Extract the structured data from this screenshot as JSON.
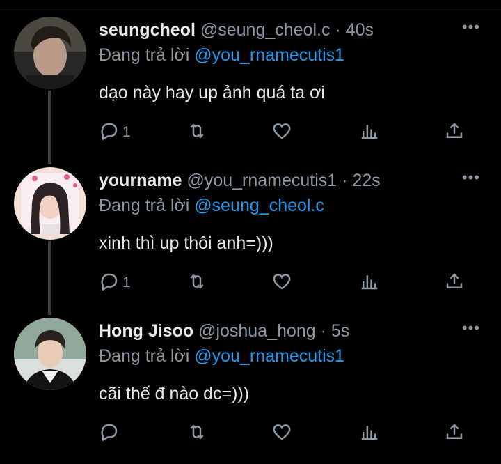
{
  "tweets": [
    {
      "name": "seungcheol",
      "handle": "@seung_cheol.c",
      "separator": "·",
      "time": "40s",
      "reply_prefix": "Đang trả lời",
      "reply_to": "@you_rnamecutis1",
      "text": "dạo này hay up ảnh quá ta ơi",
      "reply_count": "1",
      "more_label": "•••"
    },
    {
      "name": "yourname",
      "handle": "@you_rnamecutis1",
      "separator": "·",
      "time": "22s",
      "reply_prefix": "Đang trả lời",
      "reply_to": "@seung_cheol.c",
      "text": "xinh thì up thôi anh=)))",
      "reply_count": "1",
      "more_label": "•••"
    },
    {
      "name": "Hong Jisoo",
      "handle": "@joshua_hong",
      "separator": "·",
      "time": "5s",
      "reply_prefix": "Đang trả lời",
      "reply_to": "@you_rnamecutis1",
      "text": "cãi thế đ nào dc=)))",
      "reply_count": "",
      "more_label": "•••"
    }
  ],
  "icons": {
    "reply": "reply-icon",
    "retweet": "retweet-icon",
    "like": "heart-icon",
    "views": "views-icon",
    "share": "share-icon",
    "more": "more-icon"
  },
  "colors": {
    "background": "#000000",
    "text": "#e7e9ea",
    "secondary": "#8b98a5",
    "link": "#1d9bf0"
  }
}
